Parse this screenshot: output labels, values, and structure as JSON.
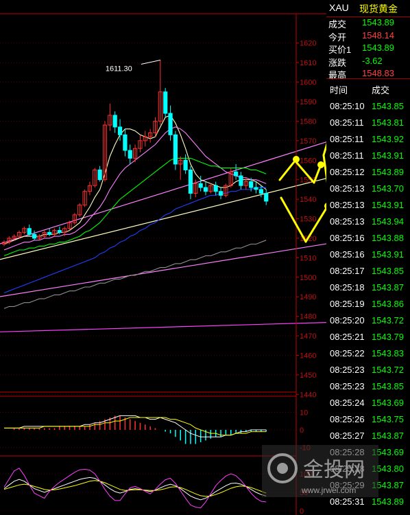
{
  "header": {
    "symbol": "XAU",
    "name": "现货黄金"
  },
  "quote": [
    {
      "label": "成交",
      "value": "1543.89",
      "color": "#00ff00"
    },
    {
      "label": "今开",
      "value": "1548.14",
      "color": "#ff4040"
    },
    {
      "label": "买价1",
      "value": "1543.89",
      "color": "#00ff00"
    },
    {
      "label": "涨跌",
      "value": "-3.62",
      "color": "#00ff00"
    },
    {
      "label": "最高",
      "value": "1548.83",
      "color": "#ff4040"
    }
  ],
  "ticks_header": {
    "time": "时间",
    "price": "成交"
  },
  "ticks": [
    {
      "time": "08:25:10",
      "price": "1543.85"
    },
    {
      "time": "08:25:11",
      "price": "1543.81"
    },
    {
      "time": "08:25:11",
      "price": "1543.92"
    },
    {
      "time": "08:25:11",
      "price": "1543.91"
    },
    {
      "time": "08:25:12",
      "price": "1543.89"
    },
    {
      "time": "08:25:13",
      "price": "1543.70"
    },
    {
      "time": "08:25:13",
      "price": "1543.91"
    },
    {
      "time": "08:25:13",
      "price": "1543.94"
    },
    {
      "time": "08:25:16",
      "price": "1543.88"
    },
    {
      "time": "08:25:16",
      "price": "1543.91"
    },
    {
      "time": "08:25:17",
      "price": "1543.85"
    },
    {
      "time": "08:25:18",
      "price": "1543.87"
    },
    {
      "time": "08:25:19",
      "price": "1543.86"
    },
    {
      "time": "08:25:20",
      "price": "1543.72"
    },
    {
      "time": "08:25:21",
      "price": "1543.79"
    },
    {
      "time": "08:25:22",
      "price": "1543.83"
    },
    {
      "time": "08:25:23",
      "price": "1543.72"
    },
    {
      "time": "08:25:23",
      "price": "1543.85"
    },
    {
      "time": "08:25:24",
      "price": "1543.69"
    },
    {
      "time": "08:25:26",
      "price": "1543.75"
    },
    {
      "time": "08:25:27",
      "price": "1543.87"
    },
    {
      "time": "08:25:28",
      "price": "1543.69"
    },
    {
      "time": "08:25:28",
      "price": "1543.80"
    },
    {
      "time": "08:25:29",
      "price": "1543.87"
    },
    {
      "time": "08:25:31",
      "price": "1543.89"
    }
  ],
  "watermark": {
    "name": "金投网",
    "url": "www.jrwei.com"
  },
  "colors": {
    "up": "#ff3030",
    "down": "#00ffff",
    "grid": "#8b0000",
    "axis": "#c00000"
  },
  "chart_data": {
    "type": "candlestick",
    "price_panel": {
      "y_ticks": [
        1620,
        1610,
        1600,
        1590,
        1580,
        1570,
        1560,
        1550,
        1540,
        1530,
        1520,
        1510,
        1500,
        1490,
        1480,
        1470,
        1460,
        1450,
        1440
      ],
      "ylim": [
        1438,
        1628
      ],
      "annotation": {
        "label": "1611.30",
        "value": 1611.3
      },
      "candles": [
        [
          1517,
          1519,
          1516,
          1518
        ],
        [
          1518,
          1521,
          1517,
          1520
        ],
        [
          1520,
          1522,
          1519,
          1521
        ],
        [
          1521,
          1524,
          1520,
          1523
        ],
        [
          1523,
          1526,
          1522,
          1525
        ],
        [
          1525,
          1527,
          1521,
          1522
        ],
        [
          1522,
          1524,
          1519,
          1520
        ],
        [
          1520,
          1522,
          1519,
          1521
        ],
        [
          1521,
          1524,
          1520,
          1523
        ],
        [
          1523,
          1525,
          1521,
          1522
        ],
        [
          1522,
          1525,
          1521,
          1524
        ],
        [
          1524,
          1526,
          1522,
          1523
        ],
        [
          1523,
          1526,
          1521,
          1525
        ],
        [
          1525,
          1529,
          1524,
          1528
        ],
        [
          1528,
          1533,
          1527,
          1532
        ],
        [
          1532,
          1538,
          1531,
          1537
        ],
        [
          1537,
          1545,
          1536,
          1544
        ],
        [
          1544,
          1549,
          1542,
          1547
        ],
        [
          1547,
          1556,
          1546,
          1555
        ],
        [
          1555,
          1557,
          1549,
          1550
        ],
        [
          1550,
          1580,
          1549,
          1578
        ],
        [
          1578,
          1589,
          1575,
          1583
        ],
        [
          1583,
          1585,
          1574,
          1577
        ],
        [
          1577,
          1581,
          1570,
          1573
        ],
        [
          1573,
          1576,
          1562,
          1565
        ],
        [
          1565,
          1568,
          1558,
          1561
        ],
        [
          1561,
          1568,
          1559,
          1566
        ],
        [
          1566,
          1573,
          1564,
          1570
        ],
        [
          1570,
          1575,
          1567,
          1572
        ],
        [
          1572,
          1576,
          1569,
          1574
        ],
        [
          1574,
          1582,
          1572,
          1580
        ],
        [
          1580,
          1611.3,
          1578,
          1595
        ],
        [
          1595,
          1597,
          1582,
          1584
        ],
        [
          1584,
          1588,
          1570,
          1573
        ],
        [
          1573,
          1575,
          1555,
          1558
        ],
        [
          1558,
          1562,
          1550,
          1560
        ],
        [
          1560,
          1563,
          1553,
          1555
        ],
        [
          1555,
          1557,
          1540,
          1543
        ],
        [
          1543,
          1550,
          1541,
          1548
        ],
        [
          1548,
          1552,
          1544,
          1546
        ],
        [
          1546,
          1549,
          1542,
          1544
        ],
        [
          1544,
          1548,
          1543,
          1547
        ],
        [
          1547,
          1549,
          1542,
          1544
        ],
        [
          1544,
          1546,
          1540,
          1542
        ],
        [
          1542,
          1548,
          1541,
          1547
        ],
        [
          1547,
          1556,
          1546,
          1554
        ],
        [
          1554,
          1558,
          1550,
          1552
        ],
        [
          1552,
          1554,
          1545,
          1547
        ],
        [
          1547,
          1551,
          1545,
          1549
        ],
        [
          1549,
          1551,
          1544,
          1546
        ],
        [
          1546,
          1549,
          1543,
          1545
        ],
        [
          1545,
          1547,
          1541,
          1543
        ],
        [
          1543,
          1545,
          1537,
          1539
        ]
      ],
      "moving_averages": [
        {
          "color": "#ffffc0",
          "values": [
            1517,
            1518,
            1519,
            1520,
            1521,
            1521,
            1521,
            1521,
            1522,
            1522,
            1522,
            1523,
            1523,
            1524,
            1526,
            1528,
            1532,
            1536,
            1541,
            1545,
            1553,
            1562,
            1568,
            1573,
            1576,
            1576,
            1575,
            1573,
            1572,
            1571,
            1572,
            1577,
            1582,
            1583,
            1579,
            1573,
            1566,
            1558,
            1553,
            1550,
            1549,
            1548,
            1547,
            1546,
            1546,
            1547,
            1549,
            1550,
            1550,
            1550,
            1549,
            1547,
            1545
          ]
        },
        {
          "color": "#ff80ff",
          "values": [
            1514,
            1515,
            1516,
            1517,
            1518,
            1518,
            1519,
            1519,
            1520,
            1520,
            1521,
            1521,
            1522,
            1522,
            1523,
            1525,
            1527,
            1530,
            1533,
            1536,
            1540,
            1545,
            1549,
            1553,
            1556,
            1558,
            1560,
            1562,
            1564,
            1566,
            1568,
            1571,
            1574,
            1576,
            1577,
            1576,
            1574,
            1571,
            1568,
            1565,
            1562,
            1560,
            1558,
            1556,
            1554,
            1553,
            1552,
            1551,
            1551,
            1550,
            1550,
            1549,
            1548
          ]
        },
        {
          "color": "#00ff00",
          "values": [
            1511,
            1512,
            1513,
            1514,
            1514,
            1515,
            1515,
            1516,
            1516,
            1517,
            1517,
            1518,
            1518,
            1519,
            1520,
            1521,
            1523,
            1524,
            1526,
            1528,
            1531,
            1534,
            1537,
            1540,
            1542,
            1544,
            1546,
            1548,
            1550,
            1552,
            1554,
            1556,
            1558,
            1560,
            1561,
            1561,
            1561,
            1561,
            1560,
            1559,
            1558,
            1557,
            1557,
            1556,
            1556,
            1556,
            1556,
            1556,
            1556,
            1555,
            1555,
            1554,
            1553
          ]
        },
        {
          "color": "#2040ff",
          "values": [
            1492,
            1493,
            1494,
            1495,
            1496,
            1497,
            1498,
            1499,
            1500,
            1501,
            1502,
            1503,
            1504,
            1505,
            1506,
            1507,
            1508,
            1509,
            1510,
            1512,
            1513,
            1515,
            1516,
            1518,
            1519,
            1521,
            1522,
            1524,
            1525,
            1527,
            1528,
            1530,
            1532,
            1533,
            1535,
            1536,
            1537,
            1538,
            1539,
            1540,
            1541,
            1542,
            1542,
            1543,
            1543,
            1544,
            1544,
            1545,
            1545,
            1545,
            1546,
            1546,
            1546
          ]
        },
        {
          "color": "#909090",
          "values": [
            1484,
            1485,
            1485,
            1486,
            1487,
            1487,
            1488,
            1489,
            1489,
            1490,
            1491,
            1491,
            1492,
            1493,
            1493,
            1494,
            1495,
            1495,
            1496,
            1497,
            1497,
            1498,
            1499,
            1499,
            1500,
            1501,
            1501,
            1502,
            1503,
            1503,
            1504,
            1505,
            1505,
            1506,
            1507,
            1507,
            1508,
            1509,
            1509,
            1510,
            1511,
            1511,
            1512,
            1513,
            1513,
            1514,
            1515,
            1515,
            1516,
            1517,
            1517,
            1518,
            1519
          ]
        }
      ],
      "trend_lines": [
        {
          "color": "#ff80ff",
          "from": [
            -1,
            1517
          ],
          "to": [
            66,
            1571
          ]
        },
        {
          "color": "#ff80ff",
          "from": [
            -1,
            1490
          ],
          "to": [
            66,
            1518
          ]
        },
        {
          "color": "#ff40ff",
          "from": [
            -1,
            1472
          ],
          "to": [
            66,
            1477
          ]
        },
        {
          "color": "#ffffc0",
          "from": [
            -1,
            1509
          ],
          "to": [
            66,
            1552
          ]
        }
      ]
    },
    "macd_panel": {
      "y_ticks": [
        10,
        0,
        -10
      ],
      "ylim": [
        -14,
        14
      ],
      "dif": [
        1,
        1,
        1,
        1,
        2,
        2,
        2,
        2,
        2,
        2,
        2,
        2,
        2,
        2,
        2,
        2,
        3,
        3,
        4,
        4,
        5,
        6,
        7,
        8,
        8,
        8,
        8,
        7,
        7,
        6,
        6,
        7,
        6,
        5,
        4,
        2,
        0,
        -2,
        -3,
        -4,
        -4,
        -4,
        -4,
        -4,
        -3,
        -3,
        -2,
        -1,
        -1,
        0,
        0,
        0,
        0
      ],
      "dea": [
        1,
        1,
        1,
        1,
        1,
        1,
        1,
        1,
        2,
        2,
        2,
        2,
        2,
        2,
        2,
        2,
        2,
        2,
        3,
        3,
        4,
        4,
        5,
        5,
        6,
        7,
        7,
        7,
        7,
        7,
        7,
        7,
        7,
        6,
        6,
        5,
        4,
        3,
        1,
        0,
        -1,
        -2,
        -2,
        -3,
        -3,
        -3,
        -2,
        -2,
        -2,
        -1,
        -1,
        -1,
        -1
      ],
      "histogram": [
        0,
        0,
        1,
        1,
        1,
        1,
        1,
        1,
        1,
        1,
        1,
        2,
        2,
        2,
        2,
        2,
        2,
        3,
        4,
        5,
        6,
        7,
        8,
        8,
        7,
        6,
        5,
        4,
        3,
        2,
        1,
        0,
        -1,
        -2,
        -4,
        -6,
        -8,
        -8,
        -8,
        -7,
        -6,
        -5,
        -4,
        -4,
        -3,
        -3,
        -2,
        -2,
        -1,
        -1,
        -1,
        -1,
        -1
      ]
    },
    "kdj_panel": {
      "y_ticks": [
        100,
        50,
        0
      ],
      "ylim": [
        0,
        100
      ],
      "k": [
        60,
        70,
        80,
        85,
        80,
        70,
        60,
        55,
        50,
        55,
        60,
        65,
        70,
        75,
        80,
        85,
        88,
        90,
        88,
        80,
        70,
        60,
        52,
        48,
        52,
        58,
        60,
        58,
        55,
        52,
        56,
        62,
        68,
        72,
        68,
        60,
        50,
        40,
        34,
        30,
        34,
        42,
        52,
        60,
        68,
        74,
        75,
        72,
        66,
        58,
        50,
        44,
        40
      ],
      "d": [
        58,
        62,
        66,
        70,
        72,
        70,
        66,
        62,
        58,
        56,
        57,
        59,
        62,
        65,
        68,
        72,
        76,
        80,
        82,
        80,
        76,
        70,
        64,
        58,
        55,
        56,
        57,
        57,
        56,
        55,
        55,
        57,
        60,
        64,
        65,
        63,
        58,
        52,
        46,
        41,
        39,
        40,
        44,
        49,
        55,
        61,
        65,
        67,
        66,
        63,
        58,
        53,
        48
      ],
      "j": [
        64,
        86,
        108,
        115,
        96,
        70,
        48,
        41,
        34,
        53,
        66,
        77,
        86,
        95,
        104,
        111,
        112,
        110,
        100,
        80,
        58,
        40,
        28,
        28,
        46,
        62,
        66,
        60,
        53,
        46,
        58,
        72,
        84,
        88,
        74,
        54,
        34,
        16,
        10,
        8,
        24,
        46,
        68,
        82,
        94,
        100,
        95,
        82,
        66,
        48,
        34,
        26,
        24
      ]
    }
  }
}
